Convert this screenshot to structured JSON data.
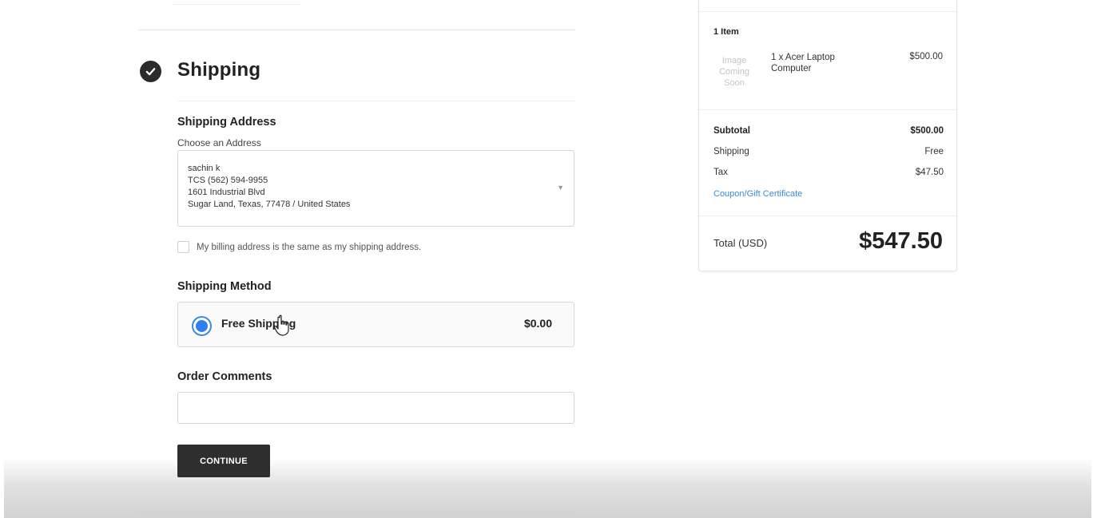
{
  "checkout": {
    "step_title": "Shipping",
    "shipping_address": {
      "heading": "Shipping Address",
      "choose_label": "Choose an Address",
      "selected_address": [
        "sachin k",
        "TCS (562) 594-9955",
        "1601 Industrial Blvd",
        "Sugar Land, Texas, 77478 / United States"
      ],
      "billing_same_label": "My billing address is the same as my shipping address.",
      "billing_same_checked": false
    },
    "shipping_method": {
      "heading": "Shipping Method",
      "option_name": "Free Shipping",
      "option_price": "$0.00",
      "selected": true
    },
    "order_comments": {
      "heading": "Order Comments",
      "value": ""
    },
    "continue_label": "CONTINUE"
  },
  "summary": {
    "items_count": "1 Item",
    "image_placeholder": [
      "Image",
      "Coming",
      "Soon"
    ],
    "item_name": "1 x Acer Laptop Computer",
    "item_price": "$500.00",
    "subtotal_label": "Subtotal",
    "subtotal_value": "$500.00",
    "shipping_label": "Shipping",
    "shipping_value": "Free",
    "tax_label": "Tax",
    "tax_value": "$47.50",
    "coupon_label": "Coupon/Gift Certificate",
    "total_label": "Total (USD)",
    "total_value": "$547.50"
  },
  "colors": {
    "accent": "#2f7ff0",
    "link": "#3a8dd6",
    "button_bg": "#2e2e2e"
  },
  "icons": {
    "step_complete": "checkmark-circle-icon",
    "address_dropdown": "chevron-down-icon",
    "cursor": "hand-pointer-icon"
  }
}
